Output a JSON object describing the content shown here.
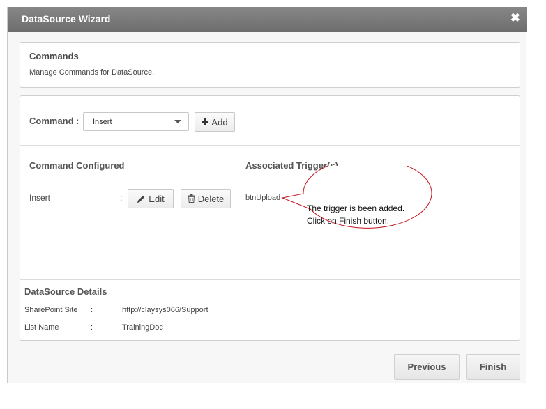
{
  "window": {
    "title": "DataSource Wizard",
    "close_glyph": "✖"
  },
  "commands_panel": {
    "heading": "Commands",
    "description": "Manage Commands for DataSource."
  },
  "command_row": {
    "label": "Command",
    "colon": ":",
    "select_value": "Insert",
    "add_button": "Add"
  },
  "configured": {
    "header_left": "Command Configured",
    "header_right": "Associated Trigger(s)",
    "row": {
      "command": "Insert",
      "colon": ":",
      "edit_label": "Edit",
      "delete_label": "Delete",
      "trigger": "btnUpload"
    }
  },
  "callout": {
    "line1": "The trigger is been added.",
    "line2": "Click on Finish button.",
    "stroke_color": "#c0141c"
  },
  "details": {
    "heading": "DataSource Details",
    "rows": [
      {
        "label": "SharePoint Site",
        "colon": ":",
        "value": "http://claysys066/Support"
      },
      {
        "label": "List Name",
        "colon": ":",
        "value": "TrainingDoc"
      }
    ]
  },
  "footer": {
    "previous": "Previous",
    "finish": "Finish"
  }
}
